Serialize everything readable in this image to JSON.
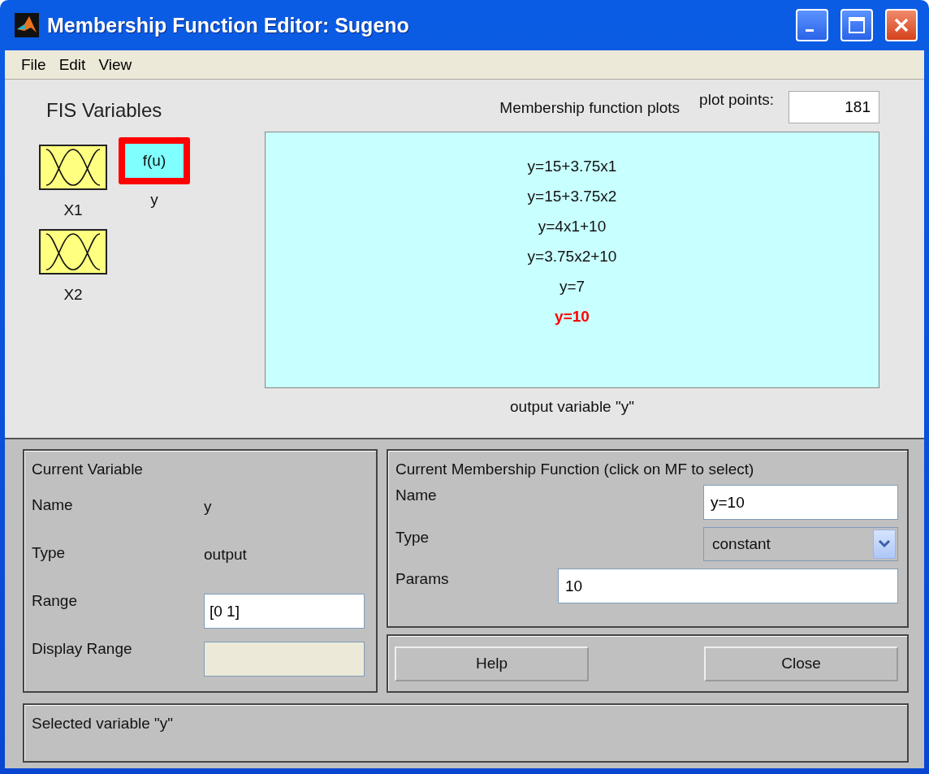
{
  "window": {
    "title": "Membership Function Editor: Sugeno"
  },
  "menu": [
    "File",
    "Edit",
    "View"
  ],
  "fis_variables": {
    "title": "FIS Variables",
    "variables": [
      {
        "label": "X1",
        "kind": "input",
        "selected": false
      },
      {
        "label": "y",
        "kind": "output",
        "icon_text": "f(u)",
        "selected": true
      },
      {
        "label": "X2",
        "kind": "input",
        "selected": false
      }
    ]
  },
  "plot": {
    "title": "Membership function plots",
    "plot_points_label": "plot points:",
    "plot_points": "181",
    "caption": "output variable \"y\"",
    "functions": [
      {
        "text": "y=15+3.75x1",
        "selected": false
      },
      {
        "text": "y=15+3.75x2",
        "selected": false
      },
      {
        "text": "y=4x1+10",
        "selected": false
      },
      {
        "text": "y=3.75x2+10",
        "selected": false
      },
      {
        "text": "y=7",
        "selected": false
      },
      {
        "text": "y=10",
        "selected": true
      }
    ]
  },
  "current_variable": {
    "title": "Current Variable",
    "rows": [
      {
        "label": "Name",
        "kind": "text",
        "value": "y"
      },
      {
        "label": "Type",
        "kind": "text",
        "value": "output"
      },
      {
        "label": "Range",
        "kind": "field",
        "value": "[0 1]"
      },
      {
        "label": "Display Range",
        "kind": "disabled_field"
      }
    ]
  },
  "current_mf": {
    "title": "Current Membership Function (click on MF to select)",
    "name_label": "Name",
    "name": "y=10",
    "type_label": "Type",
    "type": "constant",
    "params_label": "Params",
    "params": "10"
  },
  "buttons": [
    "Help",
    "Close"
  ],
  "status": "Selected variable \"y\""
}
